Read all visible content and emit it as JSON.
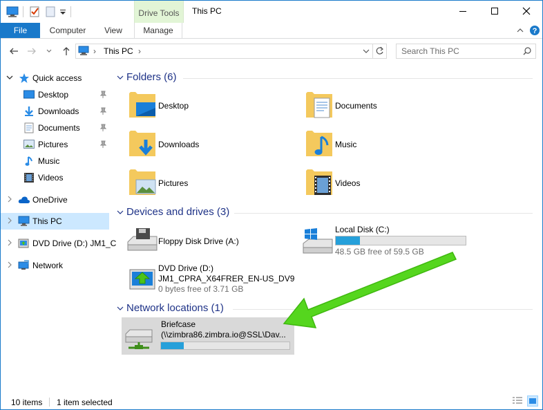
{
  "window": {
    "title": "This PC"
  },
  "ribbon": {
    "context_tab": "Drive Tools",
    "tabs": [
      {
        "label": "File"
      },
      {
        "label": "Computer"
      },
      {
        "label": "View"
      },
      {
        "label": "Manage"
      }
    ]
  },
  "address": {
    "path": "This PC",
    "search_placeholder": "Search This PC"
  },
  "nav": {
    "items": [
      {
        "label": "Quick access"
      },
      {
        "label": "Desktop"
      },
      {
        "label": "Downloads"
      },
      {
        "label": "Documents"
      },
      {
        "label": "Pictures"
      },
      {
        "label": "Music"
      },
      {
        "label": "Videos"
      },
      {
        "label": "OneDrive"
      },
      {
        "label": "This PC"
      },
      {
        "label": "DVD Drive (D:) JM1_C"
      },
      {
        "label": "Network"
      }
    ]
  },
  "content": {
    "folders_header": "Folders (6)",
    "folders": [
      {
        "label": "Desktop"
      },
      {
        "label": "Documents"
      },
      {
        "label": "Downloads"
      },
      {
        "label": "Music"
      },
      {
        "label": "Pictures"
      },
      {
        "label": "Videos"
      }
    ],
    "devices_header": "Devices and drives (3)",
    "devices": [
      {
        "label": "Floppy Disk Drive (A:)"
      },
      {
        "label": "Local Disk (C:)",
        "free": "48.5 GB free of 59.5 GB",
        "used_fraction": 0.185
      },
      {
        "label": "DVD Drive (D:)",
        "volume": "JM1_CPRA_X64FRER_EN-US_DV9",
        "free": "0 bytes free of 3.71 GB"
      }
    ],
    "network_header": "Network locations (1)",
    "network": [
      {
        "label": "Briefcase",
        "path": "(\\\\zimbra86.zimbra.io@SSL\\Dav...",
        "used_fraction": 0.18
      }
    ]
  },
  "status": {
    "items_count": "10 items",
    "selected": "1 item selected"
  },
  "colors": {
    "accent": "#1979ca",
    "selection": "#cce8ff",
    "group_header": "#1e3287",
    "drive_bar": "#26a0da",
    "arrow": "#4cd61e"
  }
}
